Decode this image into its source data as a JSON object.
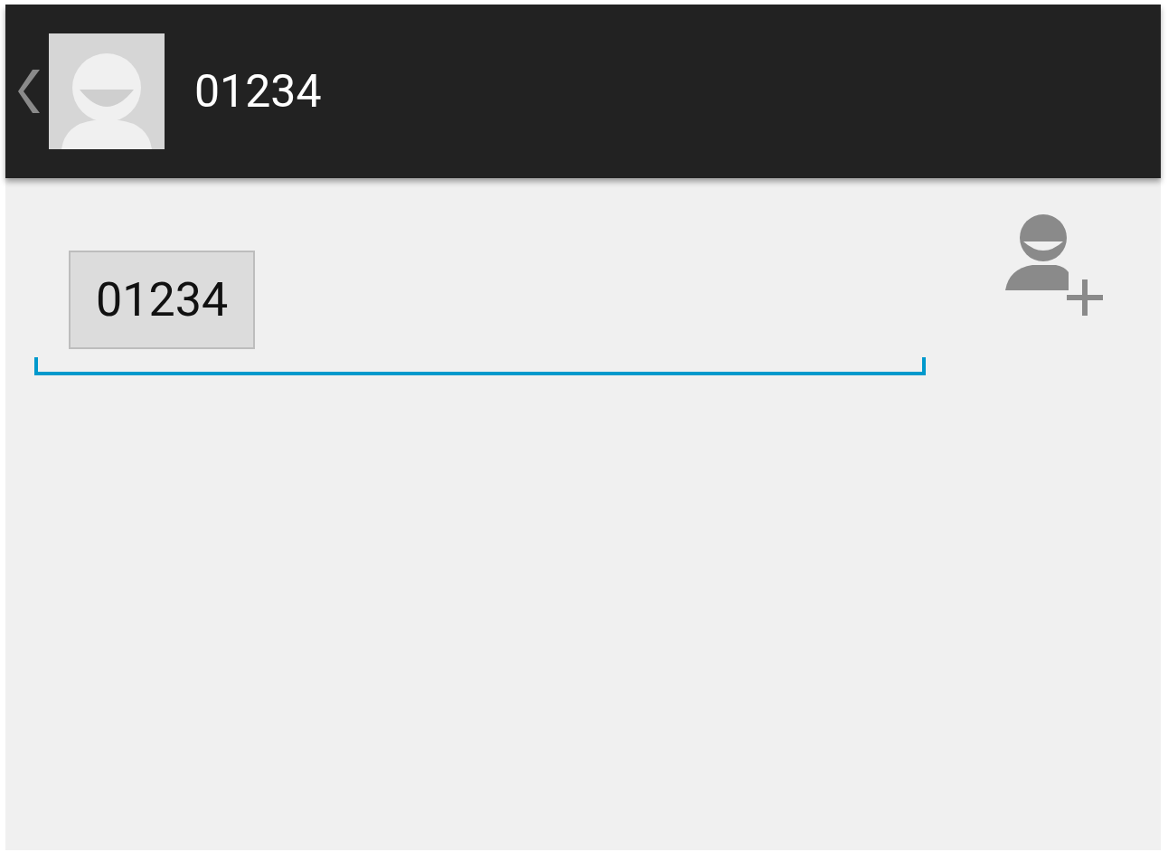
{
  "header": {
    "title": "01234"
  },
  "recipients": [
    {
      "label": "01234"
    }
  ]
}
